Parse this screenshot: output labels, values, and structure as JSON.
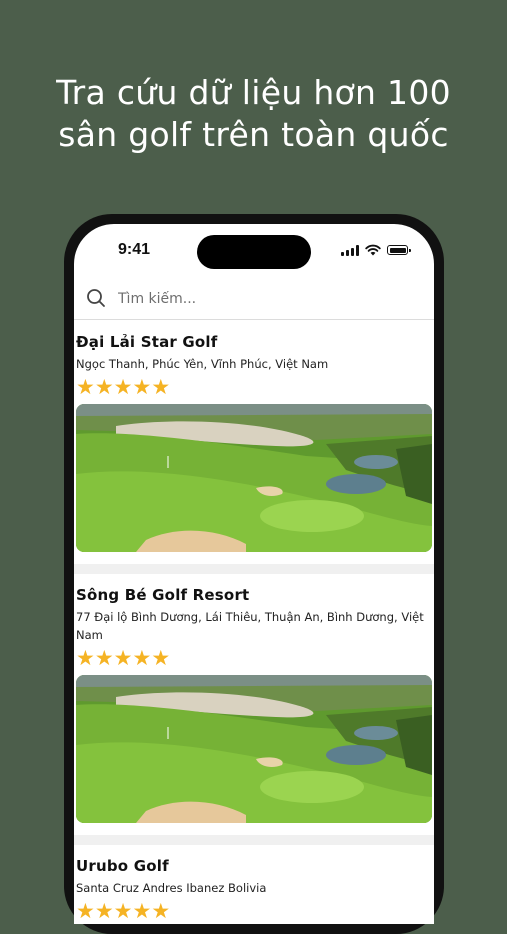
{
  "headline": {
    "line1": "Tra cứu dữ liệu hơn 100",
    "line2": "sân golf trên toàn quốc"
  },
  "status_bar": {
    "time": "9:41"
  },
  "search": {
    "placeholder": "Tìm kiếm..."
  },
  "courses": [
    {
      "name": "Đại Lải Star Golf",
      "address": "Ngọc Thanh, Phúc Yên, Vĩnh Phúc, Việt Nam",
      "rating": 5
    },
    {
      "name": "Sông Bé Golf Resort",
      "address": "77 Đại lộ Bình Dương, Lái Thiêu, Thuận An, Bình Dương, Việt Nam",
      "rating": 5
    },
    {
      "name": "Urubo Golf",
      "address": "Santa Cruz Andres Ibanez Bolivia",
      "rating": 5
    }
  ],
  "colors": {
    "background": "#4c5e4b",
    "star": "#f5b324",
    "text": "#111111"
  }
}
